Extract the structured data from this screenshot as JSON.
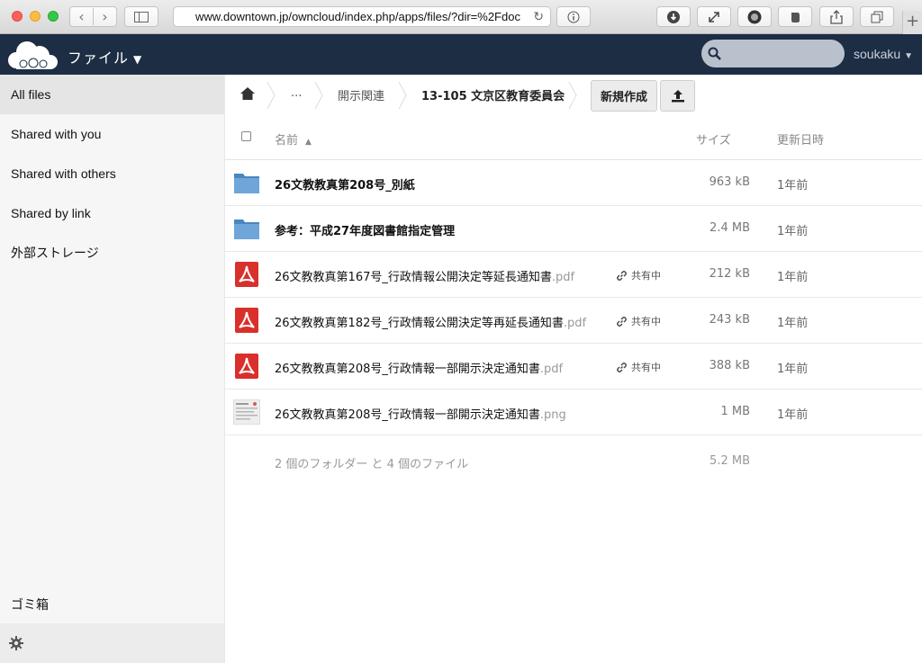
{
  "browser": {
    "url": "www.downtown.jp/owncloud/index.php/apps/files/?dir=%2Fdoc",
    "new_tab_label": "+"
  },
  "header": {
    "app_name": "ファイル",
    "user_name": "soukaku",
    "search": {
      "value": "",
      "placeholder": ""
    }
  },
  "sidebar": {
    "items": [
      {
        "label": "All files",
        "active": true
      },
      {
        "label": "Shared with you"
      },
      {
        "label": "Shared with others"
      },
      {
        "label": "Shared by link"
      },
      {
        "label": "外部ストレージ"
      }
    ],
    "trash_label": "ゴミ箱"
  },
  "breadcrumb": {
    "items": [
      "...",
      "開示関連",
      "13-105 文京区教育委員会"
    ]
  },
  "toolbar": {
    "new_label": "新規作成"
  },
  "table": {
    "headers": {
      "name": "名前",
      "size": "サイズ",
      "modified": "更新日時"
    },
    "rows": [
      {
        "type": "folder",
        "name": "26文教教真第208号_別紙",
        "ext": "",
        "shared": "",
        "size": "963 kB",
        "modified": "1年前"
      },
      {
        "type": "folder",
        "name": "参考：平成27年度図書館指定管理",
        "ext": "",
        "shared": "",
        "size": "2.4 MB",
        "modified": "1年前"
      },
      {
        "type": "pdf",
        "name": "26文教教真第167号_行政情報公開決定等延長通知書",
        "ext": ".pdf",
        "shared": "共有中",
        "size": "212 kB",
        "modified": "1年前"
      },
      {
        "type": "pdf",
        "name": "26文教教真第182号_行政情報公開決定等再延長通知書",
        "ext": ".pdf",
        "shared": "共有中",
        "size": "243 kB",
        "modified": "1年前"
      },
      {
        "type": "pdf",
        "name": "26文教教真第208号_行政情報一部開示決定通知書",
        "ext": ".pdf",
        "shared": "共有中",
        "size": "388 kB",
        "modified": "1年前"
      },
      {
        "type": "image",
        "name": "26文教教真第208号_行政情報一部開示決定通知書",
        "ext": ".png",
        "shared": "",
        "size": "1 MB",
        "modified": "1年前"
      }
    ],
    "summary": {
      "text": "2 個のフォルダー と 4 個のファイル",
      "total_size": "5.2 MB"
    }
  },
  "colors": {
    "header_bg": "#1d2d44",
    "folder": "#5b9bd5",
    "pdf": "#d9302c"
  }
}
